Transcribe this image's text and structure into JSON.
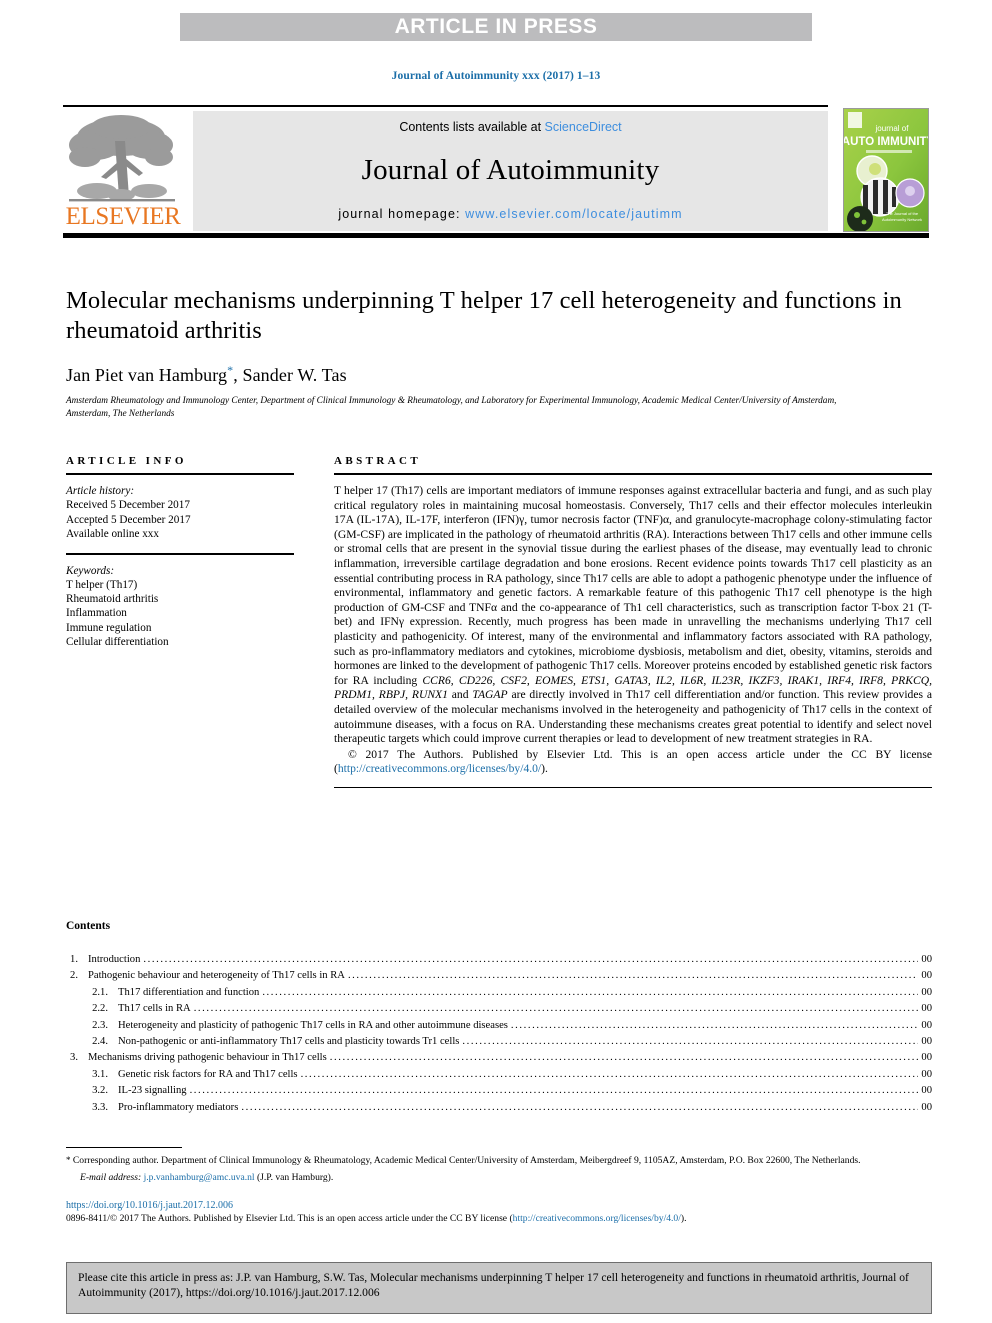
{
  "banner": {
    "text": "ARTICLE IN PRESS"
  },
  "journal_ref": "Journal of Autoimmunity xxx (2017) 1–13",
  "masthead": {
    "publisher": "ELSEVIER",
    "contents_prefix": "Contents lists available at ",
    "contents_link": "ScienceDirect",
    "journal_name": "Journal of Autoimmunity",
    "homepage_prefix": "journal homepage: ",
    "homepage_link": "www.elsevier.com/locate/jautimm",
    "cover_line1": "journal of",
    "cover_line2": "AUTO IMMUNITY"
  },
  "article": {
    "title": "Molecular mechanisms underpinning T helper 17 cell heterogeneity and functions in rheumatoid arthritis",
    "authors": "Jan Piet van Hamburg",
    "authors_rest": ", Sander W. Tas",
    "author_marker": "*",
    "affiliation": "Amsterdam Rheumatology and Immunology Center, Department of Clinical Immunology & Rheumatology, and Laboratory for Experimental Immunology, Academic Medical Center/University of Amsterdam, Amsterdam, The Netherlands"
  },
  "info": {
    "heading": "ARTICLE INFO",
    "history_label": "Article history:",
    "history": [
      "Received 5 December 2017",
      "Accepted 5 December 2017",
      "Available online xxx"
    ],
    "keywords_label": "Keywords:",
    "keywords": [
      "T helper (Th17)",
      "Rheumatoid arthritis",
      "Inflammation",
      "Immune regulation",
      "Cellular differentiation"
    ]
  },
  "abstract": {
    "heading": "ABSTRACT",
    "part1": "T helper 17 (Th17) cells are important mediators of immune responses against extracellular bacteria and fungi, and as such play critical regulatory roles in maintaining mucosal homeostasis. Conversely, Th17 cells and their effector molecules interleukin 17A (IL-17A), IL-17F, interferon (IFN)γ, tumor necrosis factor (TNF)α, and granulocyte-macrophage colony-stimulating factor (GM-CSF) are implicated in the pathology of rheumatoid arthritis (RA). Interactions between Th17 cells and other immune cells or stromal cells that are present in the synovial tissue during the earliest phases of the disease, may eventually lead to chronic inflammation, irreversible cartilage degradation and bone erosions. Recent evidence points towards Th17 cell plasticity as an essential contributing process in RA pathology, since Th17 cells are able to adopt a pathogenic phenotype under the influence of environmental, inflammatory and genetic factors. A remarkable feature of this pathogenic Th17 cell phenotype is the high production of GM-CSF and TNFα and the co-appearance of Th1 cell characteristics, such as transcription factor T-box 21 (T-bet) and IFNγ expression. Recently, much progress has been made in unravelling the mechanisms underlying Th17 cell plasticity and pathogenicity. Of interest, many of the environmental and inflammatory factors associated with RA pathology, such as pro-inflammatory mediators and cytokines, microbiome dysbiosis, metabolism and diet, obesity, vitamins, steroids and hormones are linked to the development of pathogenic Th17 cells. Moreover proteins encoded by established genetic risk factors for RA including ",
    "genes": "CCR6, CD226, CSF2, EOMES, ETS1, GATA3, IL2, IL6R, IL23R, IKZF3, IRAK1, IRF4, IRF8, PRKCQ, PRDM1, RBPJ, RUNX1",
    "genes_conj": " and ",
    "genes_last": "TAGAP",
    "part2": " are directly involved in Th17 cell differentiation and/or function. This review provides a detailed overview of the molecular mechanisms involved in the heterogeneity and pathogenicity of Th17 cells in the context of autoimmune diseases, with a focus on RA. Understanding these mechanisms creates great potential to identify and select novel therapeutic targets which could improve current therapies or lead to development of new treatment strategies in RA.",
    "copyright": "© 2017 The Authors. Published by Elsevier Ltd. This is an open access article under the CC BY license (",
    "cc_link": "http://creativecommons.org/licenses/by/4.0/",
    "copyright_end": ")."
  },
  "contents": {
    "title": "Contents",
    "page_placeholder": "00",
    "items": [
      {
        "num": "1.",
        "label": "Introduction",
        "page": "00",
        "sub": false
      },
      {
        "num": "2.",
        "label": "Pathogenic behaviour and heterogeneity of Th17 cells in RA",
        "page": "00",
        "sub": false
      },
      {
        "num": "2.1.",
        "label": "Th17 differentiation and function",
        "page": "00",
        "sub": true
      },
      {
        "num": "2.2.",
        "label": "Th17 cells in RA",
        "page": "00",
        "sub": true
      },
      {
        "num": "2.3.",
        "label": "Heterogeneity and plasticity of pathogenic Th17 cells in RA and other autoimmune diseases",
        "page": "00",
        "sub": true
      },
      {
        "num": "2.4.",
        "label": "Non-pathogenic or anti-inflammatory Th17 cells and plasticity towards Tr1 cells",
        "page": "00",
        "sub": true
      },
      {
        "num": "3.",
        "label": "Mechanisms driving pathogenic behaviour in Th17 cells",
        "page": "00",
        "sub": false
      },
      {
        "num": "3.1.",
        "label": "Genetic risk factors for RA and Th17 cells",
        "page": "00",
        "sub": true
      },
      {
        "num": "3.2.",
        "label": "IL-23 signalling",
        "page": "00",
        "sub": true
      },
      {
        "num": "3.3.",
        "label": "Pro-inflammatory mediators",
        "page": "00",
        "sub": true
      }
    ]
  },
  "footnotes": {
    "corresponding_marker": "*",
    "corresponding": " Corresponding author. Department of Clinical Immunology & Rheumatology, Academic Medical Center/University of Amsterdam, Meibergdreef 9, 1105AZ, Amsterdam, P.O. Box 22600, The Netherlands.",
    "email_label": "E-mail address:",
    "email": "j.p.vanhamburg@amc.uva.nl",
    "email_owner": " (J.P. van Hamburg).",
    "doi": "https://doi.org/10.1016/j.jaut.2017.12.006",
    "issn_prefix": "0896-8411/© 2017 The Authors. Published by Elsevier Ltd. This is an open access article under the CC BY license (",
    "issn_link": "http://creativecommons.org/licenses/by/4.0/",
    "issn_end": ")."
  },
  "citation_box": {
    "text": "Please cite this article in press as: J.P. van Hamburg, S.W. Tas, Molecular mechanisms underpinning T helper 17 cell heterogeneity and functions in rheumatoid arthritis, Journal of Autoimmunity (2017), https://doi.org/10.1016/j.jaut.2017.12.006"
  },
  "colors": {
    "banner_bg": "#bcbcbe",
    "link_blue": "#1b6ea8",
    "sd_blue": "#3e8ede",
    "elsevier_orange": "#e87722",
    "cover_green": "#8cc63e",
    "cite_bg": "#c8c8c8"
  }
}
